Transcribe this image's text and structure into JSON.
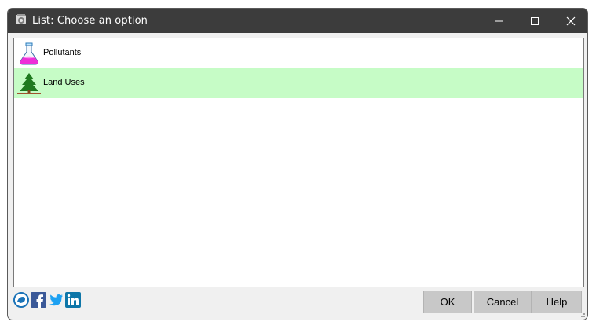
{
  "window": {
    "title": "List: Choose an option"
  },
  "list": {
    "items": [
      {
        "label": "Pollutants",
        "icon": "flask-icon",
        "selected": false
      },
      {
        "label": "Land Uses",
        "icon": "tree-icon",
        "selected": true
      }
    ],
    "selected_color": "#c6fcc6"
  },
  "social": {
    "icons": [
      "app-logo-icon",
      "facebook-icon",
      "twitter-icon",
      "linkedin-icon"
    ]
  },
  "buttons": {
    "ok": "OK",
    "cancel": "Cancel",
    "help": "Help"
  },
  "colors": {
    "titlebar": "#3c3c3c",
    "button": "#c8c8c8",
    "facebook": "#3b5998",
    "twitter": "#1da1f2",
    "linkedin": "#0e76a8"
  }
}
